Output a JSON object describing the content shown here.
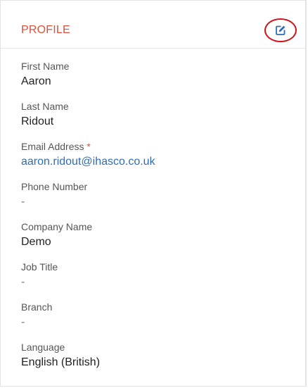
{
  "profile": {
    "title": "PROFILE",
    "edit_icon": "edit-icon",
    "colors": {
      "title": "#d9503b",
      "edit_icon": "#2f6db0",
      "link": "#2f6db0",
      "annotation_circle": "#d0121b"
    },
    "fields": [
      {
        "label": "First Name",
        "value": "Aaron"
      },
      {
        "label": "Last Name",
        "value": "Ridout"
      },
      {
        "label": "Email Address",
        "required_marker": "*",
        "value": "aaron.ridout@ihasco.co.uk"
      },
      {
        "label": "Phone Number",
        "value": "-"
      },
      {
        "label": "Company Name",
        "value": "Demo"
      },
      {
        "label": "Job Title",
        "value": "-"
      },
      {
        "label": "Branch",
        "value": "-"
      },
      {
        "label": "Language",
        "value": "English (British)"
      }
    ]
  }
}
